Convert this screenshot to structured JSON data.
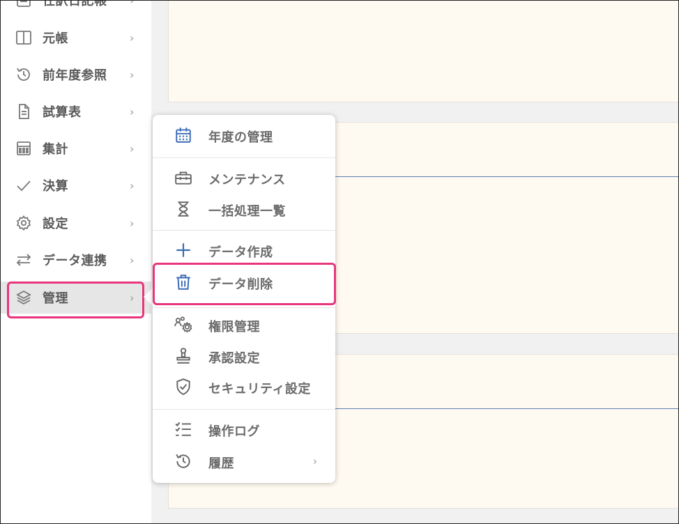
{
  "sidebar": {
    "items": [
      {
        "label": "仕訳日記帳",
        "icon": "journal-icon"
      },
      {
        "label": "元帳",
        "icon": "ledger-columns-icon"
      },
      {
        "label": "前年度参照",
        "icon": "history-icon"
      },
      {
        "label": "試算表",
        "icon": "document-icon"
      },
      {
        "label": "集計",
        "icon": "calculator-icon"
      },
      {
        "label": "決算",
        "icon": "check-icon"
      },
      {
        "label": "設定",
        "icon": "gear-icon"
      },
      {
        "label": "データ連携",
        "icon": "swap-arrows-icon"
      },
      {
        "label": "管理",
        "icon": "layers-icon"
      }
    ],
    "active": "管理"
  },
  "menu": {
    "groups": [
      [
        {
          "label": "年度の管理",
          "icon": "calendar-icon"
        }
      ],
      [
        {
          "label": "メンテナンス",
          "icon": "toolbox-icon"
        },
        {
          "label": "一括処理一覧",
          "icon": "hourglass-icon"
        }
      ],
      [
        {
          "label": "データ作成",
          "icon": "plus-icon"
        },
        {
          "label": "データ削除",
          "icon": "trash-icon"
        }
      ],
      [
        {
          "label": "権限管理",
          "icon": "users-gear-icon"
        },
        {
          "label": "承認設定",
          "icon": "stamp-icon"
        },
        {
          "label": "セキュリティ設定",
          "icon": "shield-check-icon"
        }
      ],
      [
        {
          "label": "操作ログ",
          "icon": "checklist-icon"
        },
        {
          "label": "履歴",
          "icon": "history-icon"
        }
      ]
    ]
  },
  "colors": {
    "highlight": "#e8357b",
    "accent_icon": "#3a6ab5",
    "panel_bg": "#fffaf1",
    "text_gray": "#6b6b6b"
  }
}
